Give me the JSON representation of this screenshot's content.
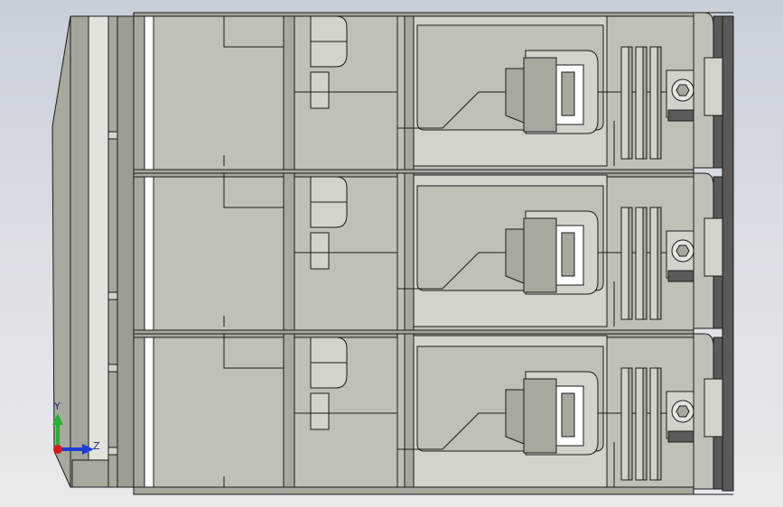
{
  "viewport": {
    "background_top": "#c9cfd8",
    "background_bottom": "#e7e9ec",
    "model_fill": "#bfc0b6",
    "model_fill_light": "#d2d3ca",
    "model_fill_dark": "#a7a89e",
    "edge_color": "#1b1b1b",
    "terminal_dark": "#5a5a58"
  },
  "triad": {
    "y_label": "Y",
    "z_label": "Z",
    "y_color": "#27b034",
    "z_color": "#1f3cd8",
    "x_color": "#d11b1b"
  }
}
